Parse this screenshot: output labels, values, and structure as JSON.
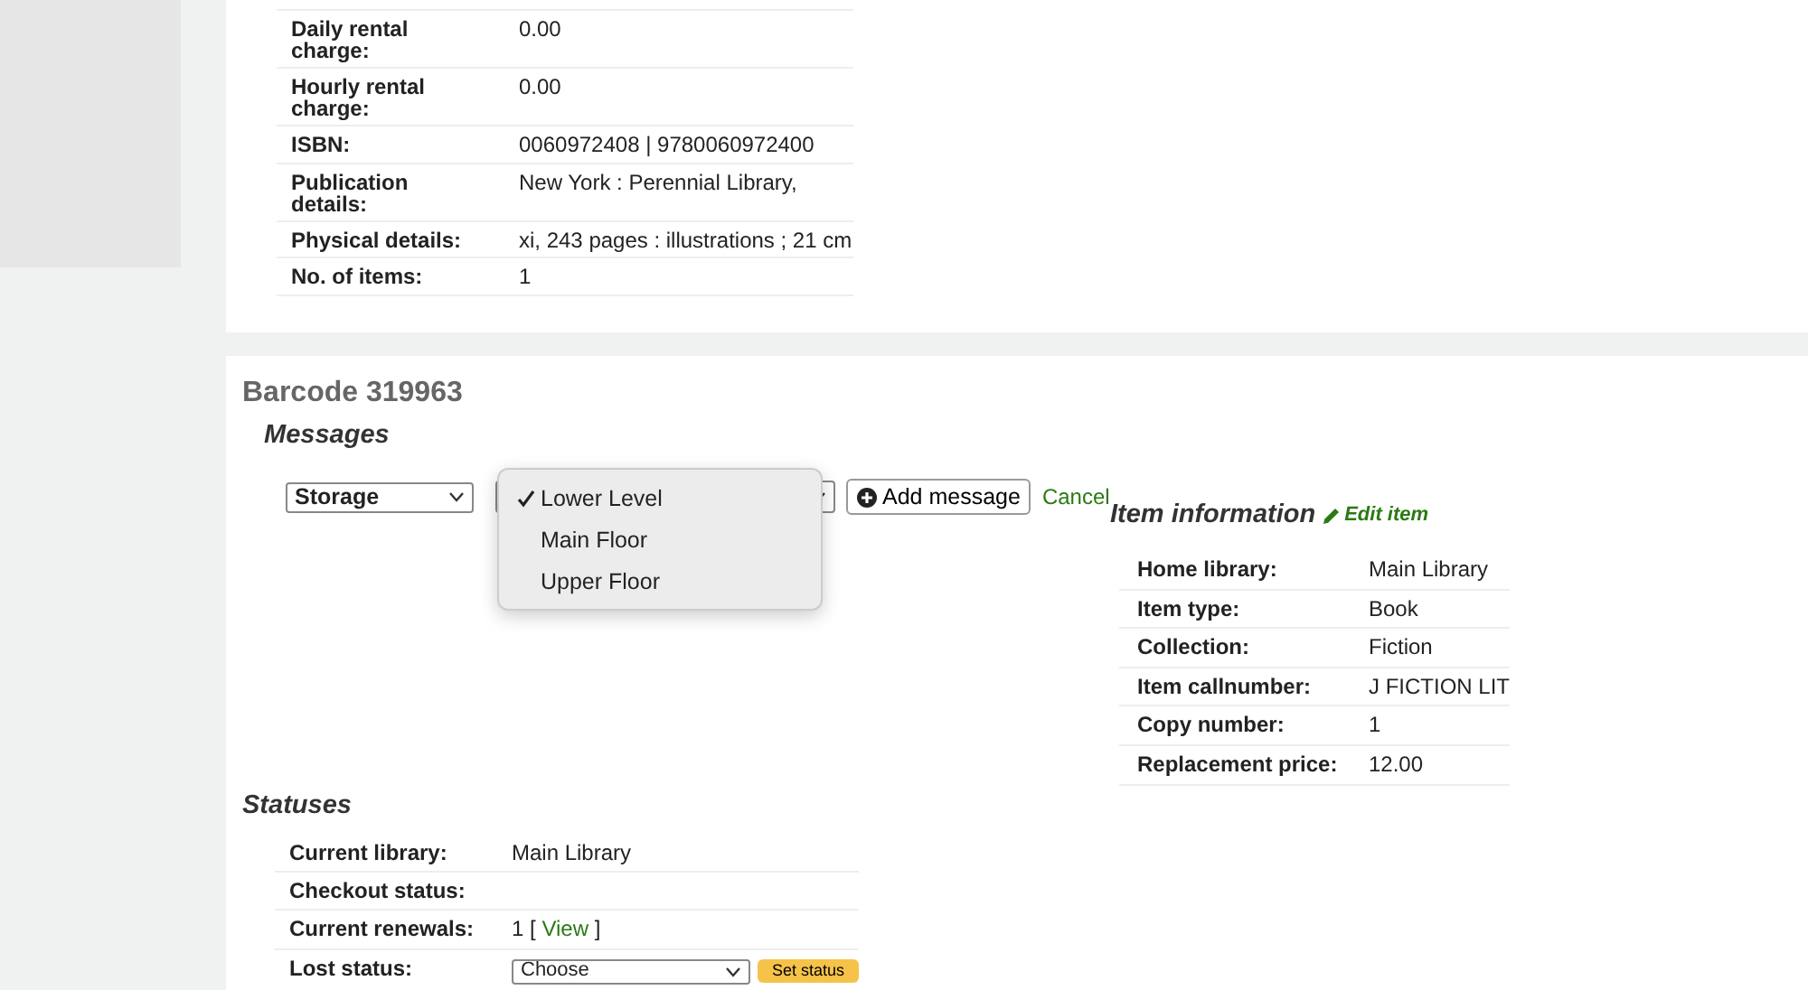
{
  "biblio_details": [
    {
      "label": "Daily rental charge:",
      "value": "0.00"
    },
    {
      "label": "Hourly rental charge:",
      "value": "0.00"
    },
    {
      "label": "ISBN:",
      "value": "0060972408 | 9780060972400"
    },
    {
      "label": "Publication details:",
      "value": "New York : Perennial Library,"
    },
    {
      "label": "Physical details:",
      "value": "xi, 243 pages : illustrations ; 21 cm"
    },
    {
      "label": "No. of items:",
      "value": "1"
    }
  ],
  "item": {
    "heading": "Barcode 319963",
    "messages": {
      "title": "Messages",
      "type_select": "Storage",
      "add_button": "Add message",
      "cancel_link": "Cancel",
      "location_options": [
        {
          "label": "Lower Level",
          "selected": true
        },
        {
          "label": "Main Floor",
          "selected": false
        },
        {
          "label": "Upper Floor",
          "selected": false
        }
      ]
    },
    "item_information": {
      "title": "Item information",
      "edit_link": "Edit item",
      "rows": [
        {
          "label": "Home library:",
          "value": "Main Library"
        },
        {
          "label": "Item type:",
          "value": "Book"
        },
        {
          "label": "Collection:",
          "value": "Fiction"
        },
        {
          "label": "Item callnumber:",
          "value": "J FICTION LIT"
        },
        {
          "label": "Copy number:",
          "value": "1"
        },
        {
          "label": "Replacement price:",
          "value": "12.00"
        }
      ]
    },
    "statuses": {
      "title": "Statuses",
      "rows": [
        {
          "kind": "text",
          "label": "Current library:",
          "value": "Main Library"
        },
        {
          "kind": "text",
          "label": "Checkout status:"
        },
        {
          "kind": "link",
          "label": "Current renewals:",
          "value": "1",
          "open": "[",
          "link": "View",
          "after": "]"
        },
        {
          "kind": "select",
          "label": "Lost status:",
          "value": "Choose",
          "button": "Set status"
        }
      ]
    }
  }
}
